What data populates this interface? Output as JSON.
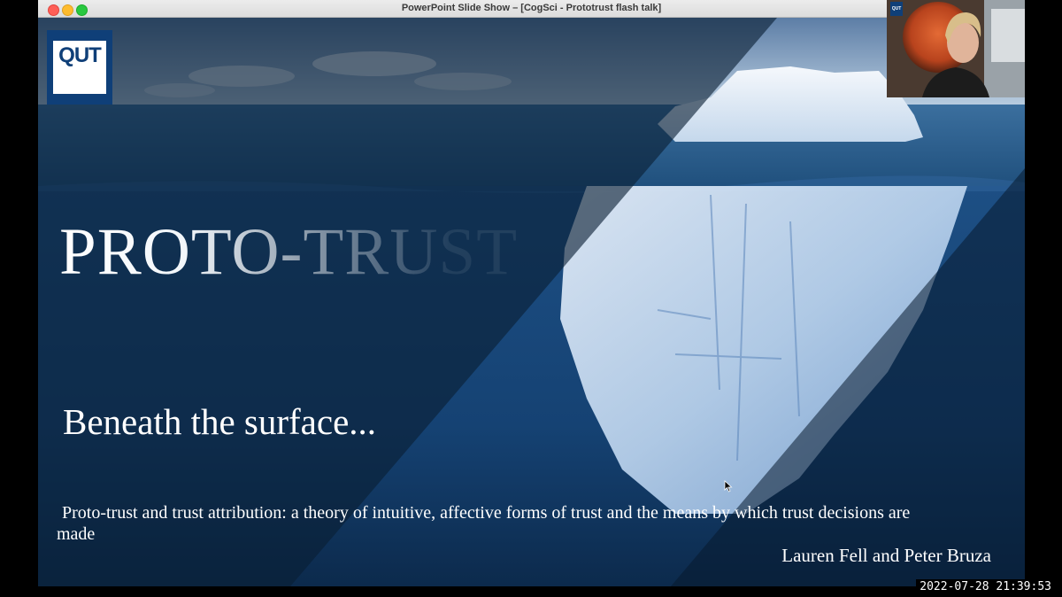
{
  "window": {
    "title": "PowerPoint Slide Show – [CogSci - Prototrust flash talk]"
  },
  "slide": {
    "logo_text": "QUT",
    "title": "PROTO-TRUST",
    "subtitle": "Beneath the surface...",
    "description": "Proto-trust and trust attribution: a theory of intuitive, affective forms of trust and the means by which trust decisions are made",
    "authors": "Lauren Fell and Peter Bruza"
  },
  "webcam": {
    "logo_text": "QUT"
  },
  "recording": {
    "timestamp": "2022-07-28  21:39:53"
  },
  "colors": {
    "titlebar": "#e6e6e6",
    "slide_dark": "#0b1a2a",
    "water_blue": "#2c6fb0",
    "qut_blue": "#0f3f78",
    "text": "#ffffff"
  },
  "icons": [
    "close-traffic-light-icon",
    "minimize-traffic-light-icon",
    "maximize-traffic-light-icon",
    "mouse-cursor-icon"
  ]
}
